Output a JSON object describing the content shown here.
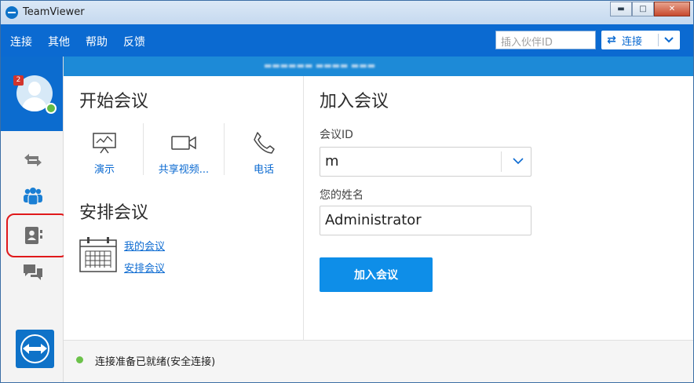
{
  "window": {
    "title": "TeamViewer",
    "minimize": "▬",
    "maximize": "□",
    "close": "✕"
  },
  "menu": {
    "items": [
      "连接",
      "其他",
      "帮助",
      "反馈"
    ]
  },
  "partner": {
    "placeholder": "插入伙伴ID",
    "connect_label": "连接"
  },
  "sidebar": {
    "badge_count": "2",
    "nav_icons": [
      "remote-control-icon",
      "meeting-icon",
      "contacts-icon",
      "chat-icon"
    ],
    "highlighted": "contacts-icon"
  },
  "start_meeting": {
    "title": "开始会议",
    "actions": [
      {
        "label": "演示",
        "icon": "presentation-icon"
      },
      {
        "label": "共享视频...",
        "icon": "video-icon"
      },
      {
        "label": "电话",
        "icon": "phone-icon"
      }
    ]
  },
  "schedule": {
    "title": "安排会议",
    "links": [
      "我的会议",
      "安排会议"
    ]
  },
  "join": {
    "title": "加入会议",
    "meeting_id_label": "会议ID",
    "meeting_id_value": "m",
    "name_label": "您的姓名",
    "name_value": "Administrator",
    "button": "加入会议"
  },
  "status": {
    "text": "连接准备已就绪(安全连接)"
  },
  "colors": {
    "brand_blue": "#0b6ad1",
    "button_blue": "#0e8ee8",
    "status_green": "#6cc24a",
    "highlight_red": "#e0191b"
  }
}
